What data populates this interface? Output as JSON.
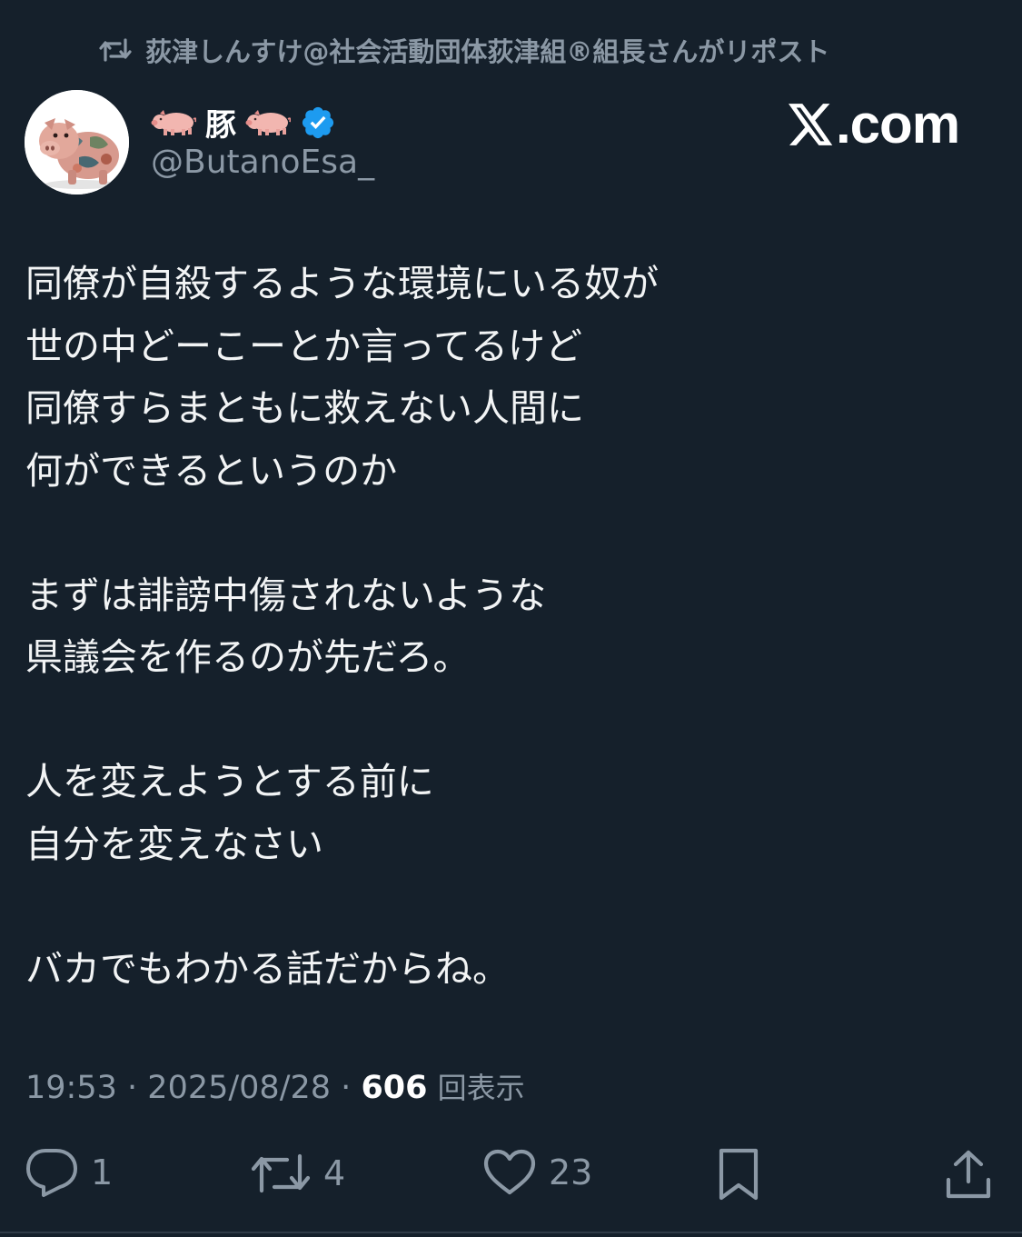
{
  "repost": {
    "icon": "repost-icon",
    "text": "荻津しんすけ@社会活動団体荻津組®組長さんがリポスト"
  },
  "author": {
    "display_name": "豚",
    "name_emoji": "pig-emoji",
    "verified_icon": "verified-badge-icon",
    "handle": "@ButanoEsa_"
  },
  "watermark": {
    "logo_icon": "x-logo-icon",
    "text": ".com"
  },
  "tweet": {
    "lines": [
      "同僚が自殺するような環境にいる奴が",
      "世の中どーこーとか言ってるけど",
      "同僚すらまともに救えない人間に",
      "何ができるというのか",
      "",
      "まずは誹謗中傷されないような",
      "県議会を作るのが先だろ。",
      "",
      "人を変えようとする前に",
      "自分を変えなさい",
      "",
      "バカでもわかる話だからね。"
    ]
  },
  "meta": {
    "time": "19:53",
    "separator": "·",
    "date": "2025/08/28",
    "views_count": "606",
    "views_label": "回表示"
  },
  "actions": {
    "reply": {
      "icon": "reply-icon",
      "count": "1"
    },
    "repost": {
      "icon": "repost-icon",
      "count": "4"
    },
    "like": {
      "icon": "heart-icon",
      "count": "23"
    },
    "bookmark": {
      "icon": "bookmark-icon"
    },
    "share": {
      "icon": "share-icon"
    }
  },
  "colors": {
    "background": "#15202b",
    "text": "#e7e9ea",
    "secondary": "#8b98a5",
    "verified": "#1d9bf0"
  }
}
